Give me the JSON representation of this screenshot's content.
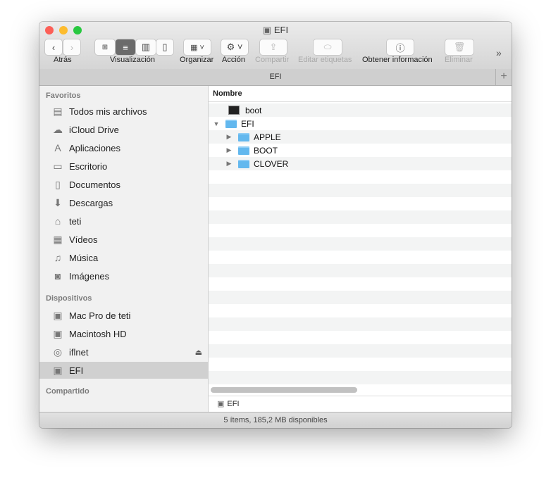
{
  "window": {
    "title": "EFI"
  },
  "toolbar": {
    "back_label": "Atrás",
    "view_label": "Visualización",
    "arrange_label": "Organizar",
    "action_label": "Acción",
    "share_label": "Compartir",
    "tags_label": "Editar etiquetas",
    "info_label": "Obtener información",
    "delete_label": "Eliminar",
    "overflow": "»"
  },
  "tab": {
    "label": "EFI",
    "add": "+"
  },
  "sidebar": {
    "favorites_header": "Favoritos",
    "favorites": [
      {
        "label": "Todos mis archivos",
        "icon": "▤"
      },
      {
        "label": "iCloud Drive",
        "icon": "☁"
      },
      {
        "label": "Aplicaciones",
        "icon": "A"
      },
      {
        "label": "Escritorio",
        "icon": "▭"
      },
      {
        "label": "Documentos",
        "icon": "▯"
      },
      {
        "label": "Descargas",
        "icon": "⬇"
      },
      {
        "label": "teti",
        "icon": "⌂"
      },
      {
        "label": "Vídeos",
        "icon": "▦"
      },
      {
        "label": "Música",
        "icon": "♫"
      },
      {
        "label": "Imágenes",
        "icon": "◙"
      }
    ],
    "devices_header": "Dispositivos",
    "devices": [
      {
        "label": "Mac Pro de teti",
        "icon": "▣"
      },
      {
        "label": "Macintosh HD",
        "icon": "▣"
      },
      {
        "label": "iflnet",
        "icon": "◎"
      },
      {
        "label": "EFI",
        "icon": "▣"
      }
    ],
    "eject": "⏏",
    "shared_header": "Compartido"
  },
  "list": {
    "column": "Nombre",
    "rows": [
      {
        "name": "boot"
      },
      {
        "name": "EFI"
      },
      {
        "name": "APPLE"
      },
      {
        "name": "BOOT"
      },
      {
        "name": "CLOVER"
      }
    ]
  },
  "pathbar": {
    "label": "EFI"
  },
  "status": {
    "text": "5 ítems, 185,2 MB disponibles"
  }
}
